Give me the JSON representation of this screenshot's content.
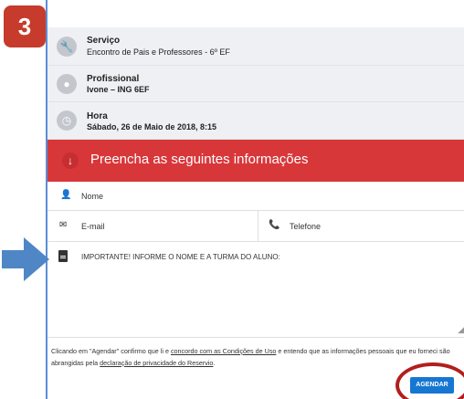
{
  "badge": {
    "number": "3"
  },
  "service": {
    "title": "Serviço",
    "value": "Encontro de Pais e Professores - 6º EF"
  },
  "professional": {
    "title": "Profissional",
    "value": "Ivone  – ING 6EF"
  },
  "time": {
    "title": "Hora",
    "value": "Sábado, 26 de Maio de 2018, 8:15"
  },
  "banner": {
    "text": "Preencha as seguintes informações",
    "color": "#d8373a"
  },
  "form": {
    "name_placeholder": "Nome",
    "email_placeholder": "E-mail",
    "phone_placeholder": "Telefone",
    "notes_placeholder": "IMPORTANTE! INFORME O NOME E A TURMA DO ALUNO:"
  },
  "terms": {
    "part1": "Clicando em \"Agendar\" confirmo que li e ",
    "link1": "concordo com as Condições de Uso",
    "part2": " e entendo que as informações pessoais que eu forneci são abrangidas pela ",
    "link2": "declaração de privacidade do Reservio",
    "part3": "."
  },
  "actions": {
    "submit_label": "AGENDAR"
  },
  "colors": {
    "accent_blue": "#1677d2",
    "highlight_red": "#b21e1e",
    "arrow_blue": "#4f86c6"
  }
}
